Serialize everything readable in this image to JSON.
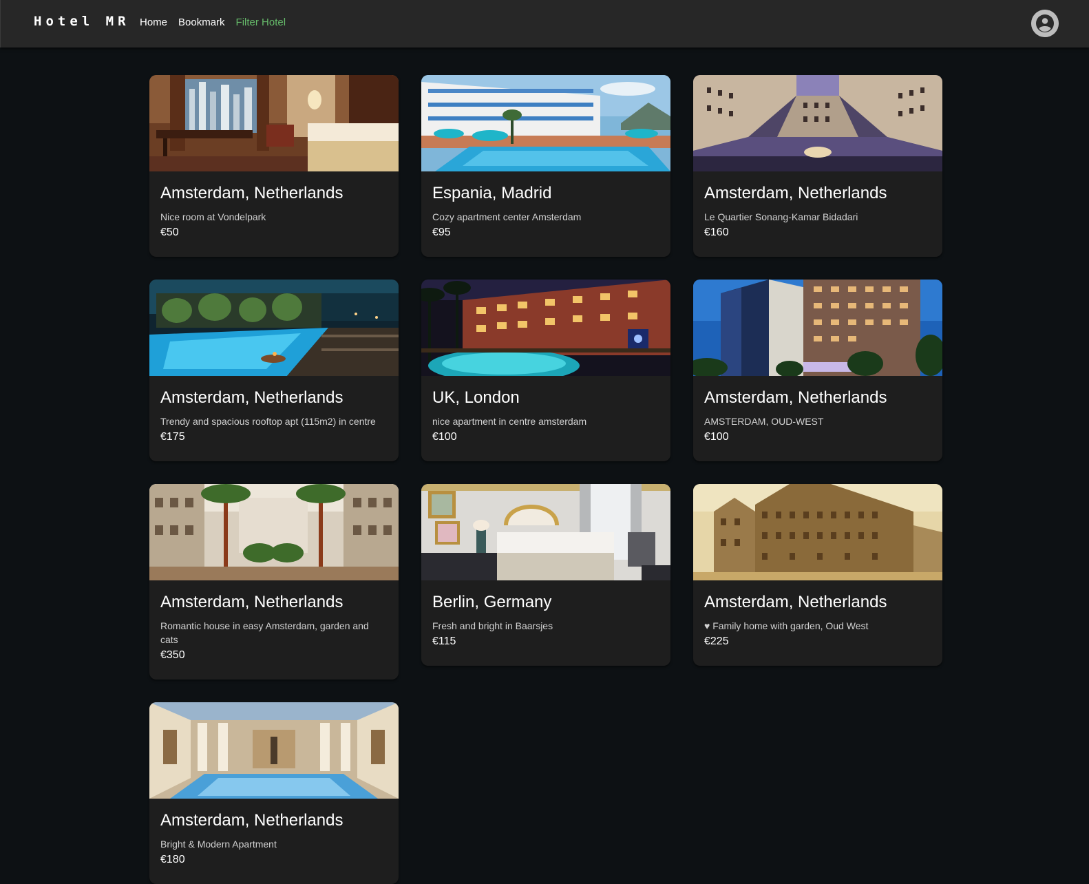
{
  "app": {
    "brand": "Hotel MR",
    "nav": [
      {
        "label": "Home",
        "active": false
      },
      {
        "label": "Bookmark",
        "active": false
      },
      {
        "label": "Filter Hotel",
        "active": true
      }
    ],
    "active_color": "#66bb6a",
    "avatar_icon": "account-circle-icon"
  },
  "hotels": [
    {
      "title": "Amsterdam, Netherlands",
      "description": "Nice room at Vondelpark",
      "price": "€50",
      "image": "hotel-room"
    },
    {
      "title": "Espania, Madrid",
      "description": "Cozy apartment center Amsterdam",
      "price": "€95",
      "image": "resort-pool"
    },
    {
      "title": "Amsterdam, Netherlands",
      "description": "Le Quartier Sonang-Kamar Bidadari",
      "price": "€160",
      "image": "courtyard-building"
    },
    {
      "title": "Amsterdam, Netherlands",
      "description": "Trendy and spacious rooftop apt (115m2) in centre",
      "price": "€175",
      "image": "rooftop-pool-night"
    },
    {
      "title": "UK, London",
      "description": "nice apartment in centre amsterdam",
      "price": "€100",
      "image": "resort-night"
    },
    {
      "title": "Amsterdam, Netherlands",
      "description": "AMSTERDAM, OUD-WEST",
      "price": "€100",
      "image": "hotel-facade-dusk"
    },
    {
      "title": "Amsterdam, Netherlands",
      "description": "Romantic house in easy Amsterdam, garden and cats",
      "price": "€350",
      "image": "palm-atrium"
    },
    {
      "title": "Berlin, Germany",
      "description": "Fresh and bright in Baarsjes",
      "price": "€115",
      "image": "bedroom-bright"
    },
    {
      "title": "Amsterdam, Netherlands",
      "description": "♥ Family home with garden, Oud West",
      "price": "€225",
      "image": "palace-sepia"
    },
    {
      "title": "Amsterdam, Netherlands",
      "description": "Bright & Modern Apartment",
      "price": "€180",
      "image": "indoor-pool"
    }
  ]
}
